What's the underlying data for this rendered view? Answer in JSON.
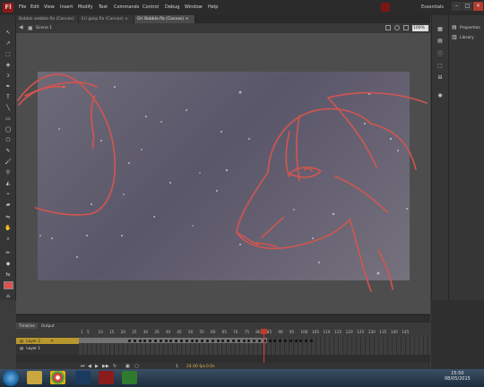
{
  "menubar": {
    "logo": "Fl",
    "items": [
      "File",
      "Edit",
      "View",
      "Insert",
      "Modify",
      "Text",
      "Commands",
      "Control",
      "Debug",
      "Window",
      "Help"
    ],
    "workspace": "Essentials",
    "window_buttons": [
      "–",
      "□",
      "✕"
    ]
  },
  "tabs": [
    {
      "label": "Bobble wobble.fla (Canvas)",
      "close": "×"
    },
    {
      "label": "Eri gasp.fla (Canvas)",
      "close": "×"
    },
    {
      "label": "Ori Bobble.fla (Canvas)",
      "close": "×"
    }
  ],
  "scene": {
    "label": "Scene 1",
    "zoom": "100%"
  },
  "right_panel": {
    "items": [
      "Properties",
      "Library"
    ]
  },
  "timeline": {
    "tabs": [
      "Timeline",
      "Output"
    ],
    "frame_numbers": [
      "1",
      "5",
      "10",
      "15",
      "20",
      "25",
      "30",
      "35",
      "40",
      "45",
      "50",
      "55",
      "60",
      "65",
      "70",
      "75",
      "80",
      "85",
      "90",
      "95",
      "100",
      "105",
      "110",
      "115",
      "120",
      "125",
      "130",
      "135",
      "140",
      "145"
    ],
    "layers": [
      {
        "name": "Layer 2",
        "selected": true
      },
      {
        "name": "Layer 1",
        "selected": false
      }
    ],
    "current_frame": "1",
    "fps": "24.00 fps",
    "time": "0.0s",
    "playhead_frame": 74
  },
  "taskbar": {
    "time": "15:50",
    "date": "08/05/2015"
  },
  "colors": {
    "stage": "#6a6676",
    "sketch": "#d9534f",
    "layer_selected": "#b8972e",
    "playhead": "#d23c2c"
  }
}
